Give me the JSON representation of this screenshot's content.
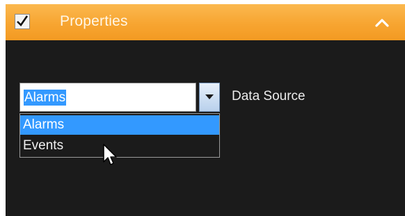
{
  "header": {
    "title": "Properties",
    "checkbox_checked": true,
    "collapse_icon": "chevron-up-icon",
    "background_color": "#f7a531"
  },
  "data_source": {
    "label": "Data Source",
    "selected_value": "Alarms",
    "dropdown_open": true,
    "options": [
      {
        "label": "Alarms",
        "highlighted": true
      },
      {
        "label": "Events",
        "highlighted": false
      }
    ],
    "highlight_color": "#3399ff"
  },
  "panel": {
    "background_color": "#1b1b1b"
  }
}
